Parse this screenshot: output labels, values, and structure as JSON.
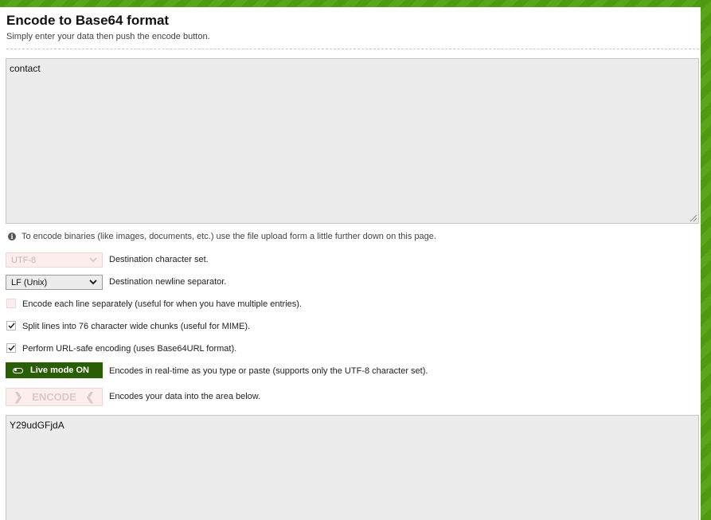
{
  "page": {
    "title": "Encode to Base64 format",
    "subtitle": "Simply enter your data then push the encode button."
  },
  "input": {
    "value": "contact"
  },
  "info": {
    "text": "To encode binaries (like images, documents, etc.) use the file upload form a little further down on this page."
  },
  "options": {
    "charset": {
      "selected": "UTF-8",
      "label": "Destination character set.",
      "disabled": true
    },
    "newline": {
      "selected": "LF (Unix)",
      "label": "Destination newline separator."
    },
    "each_line": {
      "checked": false,
      "label": "Encode each line separately (useful for when you have multiple entries)."
    },
    "split_lines": {
      "checked": true,
      "label": "Split lines into 76 character wide chunks (useful for MIME)."
    },
    "url_safe": {
      "checked": true,
      "label": "Perform URL-safe encoding (uses Base64URL format)."
    }
  },
  "live_mode": {
    "button_label": "Live mode ON",
    "description": "Encodes in real-time as you type or paste (supports only the UTF-8 character set)."
  },
  "encode": {
    "button_label": "ENCODE",
    "description": "Encodes your data into the area below."
  },
  "output": {
    "value": "Y29udGFjdA"
  },
  "colors": {
    "brand_green": "#4f9a13",
    "live_button": "#2a5e05",
    "disabled_pink": "#fdeeee",
    "textarea_bg": "#ececec"
  }
}
